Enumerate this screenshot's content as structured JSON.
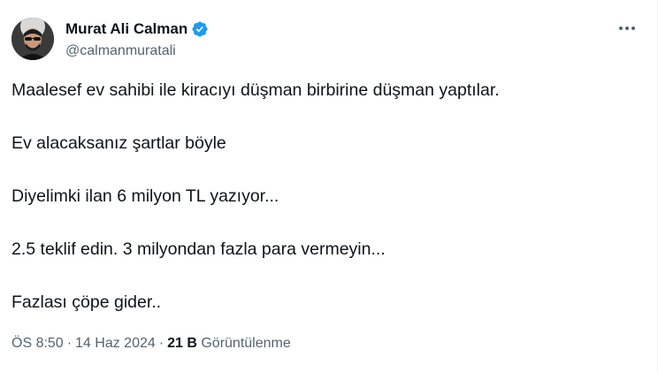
{
  "author": {
    "display_name": "Murat Ali Calman",
    "handle": "@calmanmuratali",
    "verified": true
  },
  "icons": {
    "more": "more-horizontal-icon",
    "verified": "verified-badge-icon",
    "verified_color": "#1d9bf0"
  },
  "tweet": {
    "lines": [
      "Maalesef ev sahibi ile kiracıyı düşman birbirine düşman yaptılar.",
      "Ev alacaksanız şartlar böyle",
      "Diyelimki ilan 6 milyon TL yazıyor...",
      "2.5 teklif edin. 3 milyondan fazla para vermeyin...",
      "Fazlası çöpe gider.."
    ]
  },
  "meta": {
    "time": "ÖS 8:50",
    "separator": "·",
    "date": "14 Haz 2024",
    "views_count": "21 B",
    "views_label": "Görüntülenme"
  }
}
